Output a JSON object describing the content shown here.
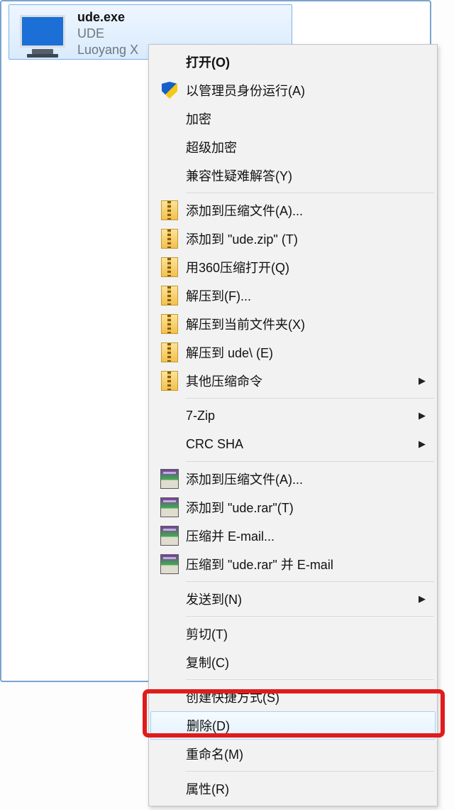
{
  "file": {
    "name": "ude.exe",
    "line2": "UDE",
    "line3": "Luoyang X"
  },
  "menu": {
    "open": "打开(O)",
    "runas": "以管理员身份运行(A)",
    "encrypt": "加密",
    "superEncrypt": "超级加密",
    "compat": "兼容性疑难解答(Y)",
    "addArchive": "添加到压缩文件(A)...",
    "addZip": "添加到 \"ude.zip\" (T)",
    "open360": "用360压缩打开(Q)",
    "extractTo": "解压到(F)...",
    "extractHere": "解压到当前文件夹(X)",
    "extractUde": "解压到 ude\\ (E)",
    "otherZip": "其他压缩命令",
    "sevenZip": "7-Zip",
    "crc": "CRC SHA",
    "rarAdd": "添加到压缩文件(A)...",
    "rarAddUde": "添加到 \"ude.rar\"(T)",
    "rarEmail": "压缩并 E-mail...",
    "rarUdeEmail": "压缩到 \"ude.rar\" 并 E-mail",
    "sendTo": "发送到(N)",
    "cut": "剪切(T)",
    "copy": "复制(C)",
    "shortcut": "创建快捷方式(S)",
    "delete": "删除(D)",
    "rename": "重命名(M)",
    "props": "属性(R)"
  }
}
